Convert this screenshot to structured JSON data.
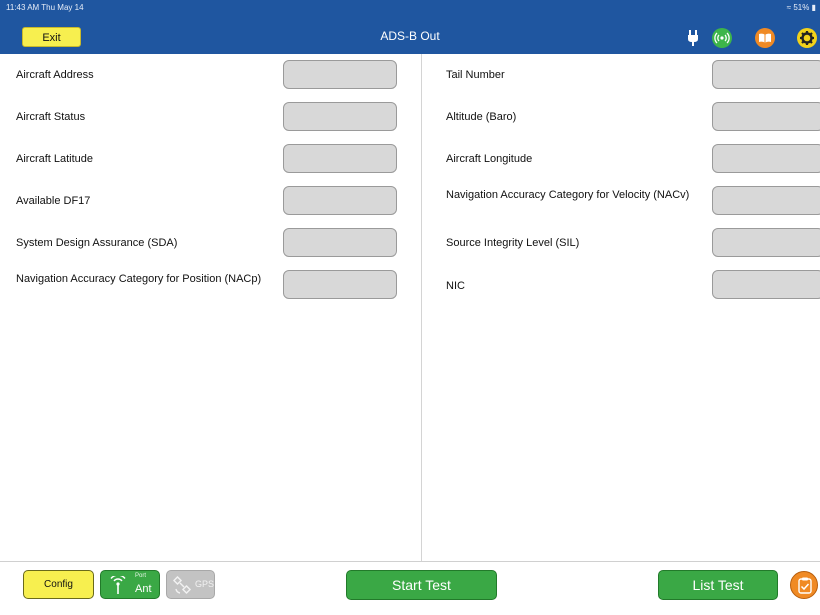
{
  "status_bar": {
    "time": "11:43 AM  Thu May 14",
    "battery": "51%"
  },
  "header": {
    "exit_label": "Exit",
    "title": "ADS-B Out",
    "icons": [
      "plug-icon",
      "radio-signal-icon",
      "book-icon",
      "gear-icon"
    ]
  },
  "left_fields": [
    {
      "label": "Aircraft Address",
      "value": ""
    },
    {
      "label": "Aircraft Status",
      "value": ""
    },
    {
      "label": "Aircraft Latitude",
      "value": ""
    },
    {
      "label": "Available DF17",
      "value": ""
    },
    {
      "label": "System Design Assurance (SDA)",
      "value": ""
    },
    {
      "label": "Navigation Accuracy Category for Position (NACp)",
      "value": ""
    }
  ],
  "right_fields": [
    {
      "label": "Tail Number",
      "value": ""
    },
    {
      "label": "Altitude (Baro)",
      "value": ""
    },
    {
      "label": "Aircraft Longitude",
      "value": ""
    },
    {
      "label": "Navigation Accuracy Category for Velocity (NACv)",
      "value": ""
    },
    {
      "label": "Source Integrity Level (SIL)",
      "value": ""
    },
    {
      "label": "NIC",
      "value": ""
    }
  ],
  "bottom": {
    "config_label": "Config",
    "ant_port_label": "Port",
    "ant_label": "Ant",
    "gps_label": "GPS",
    "start_label": "Start Test",
    "list_label": "List Test"
  },
  "colors": {
    "header_bg": "#1f56a0",
    "yellow_button": "#f7ef4f",
    "green_button": "#3aa845",
    "orange_icon": "#f08a24",
    "disabled_button": "#c3c3c3",
    "field_bg": "#d8d8d8"
  }
}
